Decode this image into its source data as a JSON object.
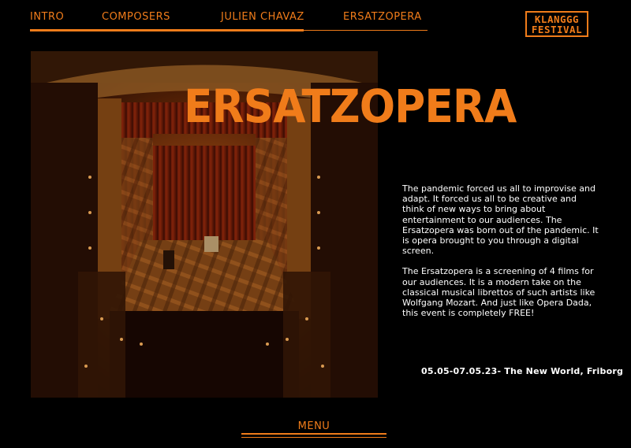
{
  "nav": {
    "items": [
      {
        "label": "INTRO"
      },
      {
        "label": "COMPOSERS"
      },
      {
        "label": "JULIEN CHAVAZ"
      },
      {
        "label": "ERSATZOPERA"
      }
    ]
  },
  "logo": {
    "line1": "KLANGGG",
    "line2": "FESTIVAL"
  },
  "main": {
    "title": "ERSATZOPERA",
    "paragraphs": [
      "The pandemic forced us all to improvise and adapt. It forced us all to be creative and think of new ways to bring about entertainment to our audiences. The Ersatzopera was born out of the pandemic. It is opera brought to you through a digital screen.",
      "The Ersatzopera is a screening of 4 films for our audiences. It is a modern take on the classical musical librettos of such artists like Wolfgang Mozart. And just like Opera Dada, this event is completely FREE!"
    ],
    "event": "05.05-07.05.23- The New World, Friborg"
  },
  "footer": {
    "menu_label": "MENU"
  },
  "colors": {
    "accent": "#f07c1a",
    "background": "#000000",
    "text": "#ffffff"
  }
}
